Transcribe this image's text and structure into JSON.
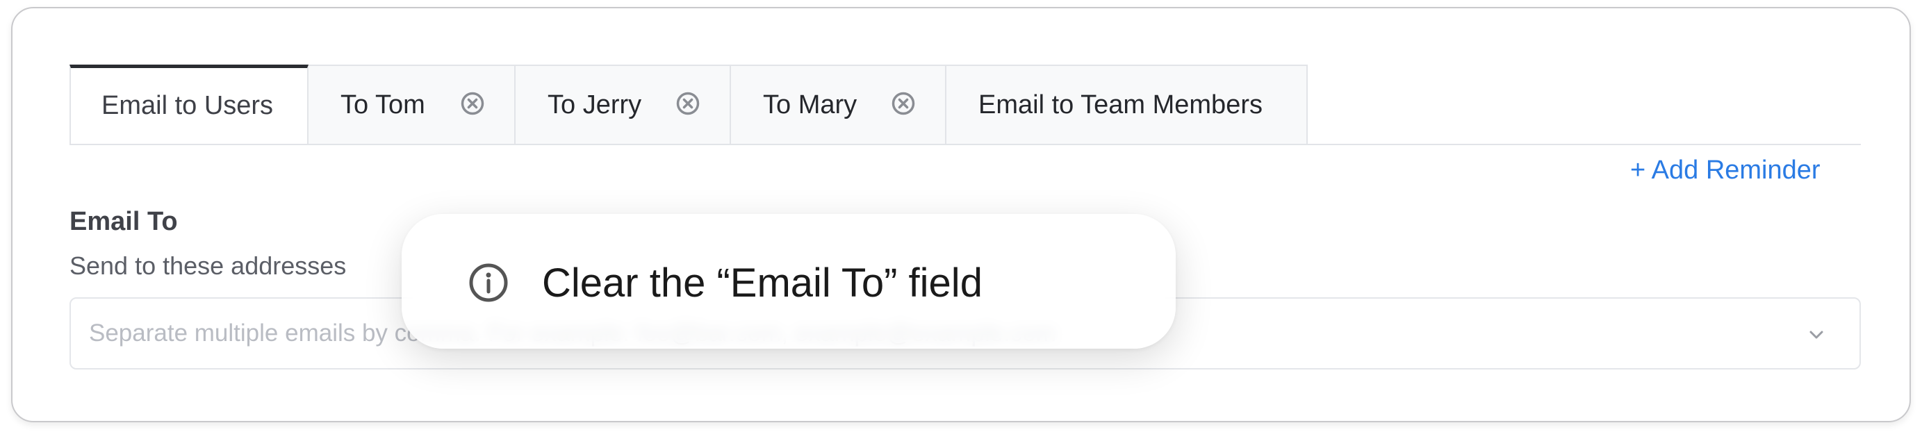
{
  "tabs": [
    {
      "label": "Email to Users",
      "active": true,
      "closable": false
    },
    {
      "label": "To Tom",
      "active": false,
      "closable": true
    },
    {
      "label": "To Jerry",
      "active": false,
      "closable": true
    },
    {
      "label": "To Mary",
      "active": false,
      "closable": true
    },
    {
      "label": "Email to Team Members",
      "active": false,
      "closable": false
    }
  ],
  "actions": {
    "add_reminder": "+ Add Reminder"
  },
  "email_field": {
    "label": "Email To",
    "help": "Send to these addresses",
    "placeholder": "Separate multiple emails by comma. For example: foo@bar.com, example@example.com",
    "value": ""
  },
  "tooltip": {
    "text": "Clear the “Email To” field",
    "icon": "info-icon"
  },
  "colors": {
    "accent": "#2a7be4",
    "active_tab_border": "#2a2c31",
    "tab_bg": "#f8f9fa"
  }
}
